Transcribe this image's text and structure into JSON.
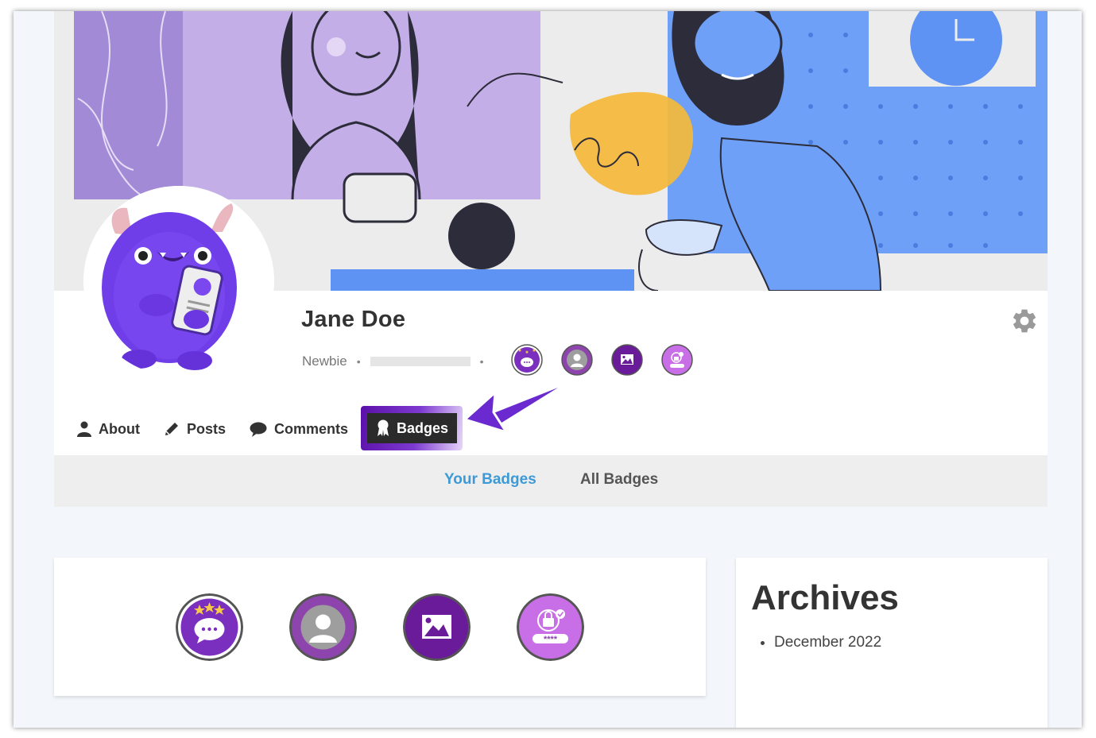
{
  "profile": {
    "name": "Jane Doe",
    "role": "Newbie",
    "separator": "•"
  },
  "tabs": {
    "about": "About",
    "posts": "Posts",
    "comments": "Comments",
    "badges": "Badges",
    "active": "Badges"
  },
  "subnav": {
    "your_badges": "Your Badges",
    "all_badges": "All Badges",
    "active": "Your Badges"
  },
  "badges": [
    {
      "name": "comment-stars-badge",
      "color": "#7b2fbe"
    },
    {
      "name": "user-avatar-badge",
      "color": "#8e44ad"
    },
    {
      "name": "image-badge",
      "color": "#6a1b9a"
    },
    {
      "name": "password-lock-badge",
      "color": "#c86ee6"
    }
  ],
  "sidebar": {
    "archives_title": "Archives",
    "archive_items": [
      "December 2022"
    ]
  },
  "colors": {
    "accent_link": "#3d9ad6",
    "active_tab_bg": "#2b2b2b",
    "highlight_purple": "#6a2ad0"
  },
  "icons": {
    "about": "user-icon",
    "posts": "pencil-icon",
    "comments": "chat-bubble-icon",
    "badges": "award-ribbon-icon",
    "settings": "gear-icon"
  }
}
